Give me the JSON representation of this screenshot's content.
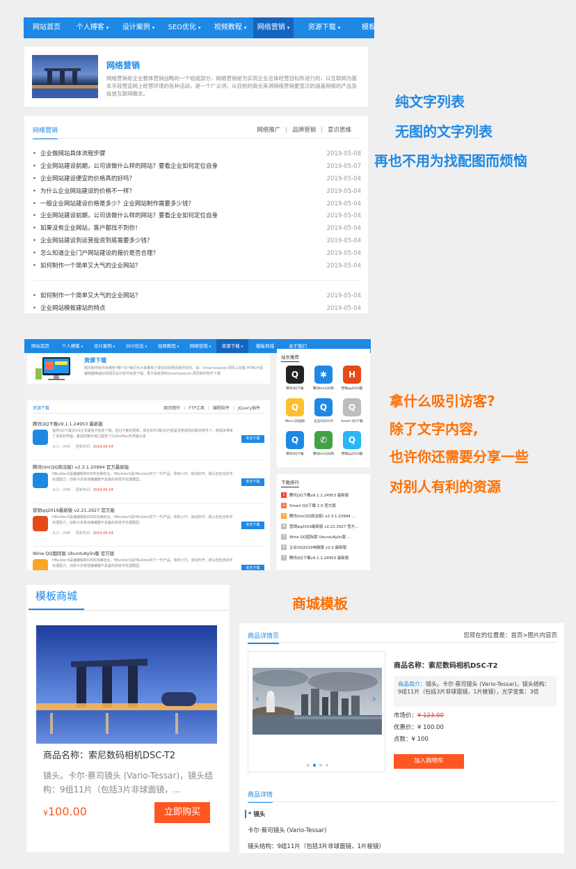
{
  "nav1": {
    "items": [
      {
        "label": "网站首页",
        "dd": false
      },
      {
        "label": "个人搏客",
        "dd": true
      },
      {
        "label": "设计案例",
        "dd": true
      },
      {
        "label": "SEO优化",
        "dd": true
      },
      {
        "label": "视频教程",
        "dd": true
      },
      {
        "label": "网络营销",
        "dd": true,
        "active": true
      },
      {
        "label": "资源下载",
        "dd": true
      },
      {
        "label": "模板商城",
        "dd": false
      }
    ],
    "caret": "▾"
  },
  "intro": {
    "title": "网络营销",
    "text": "网络营销是企业整体营销战略的一个组成部分，网络营销是为实现企业总体经营目标所进行的，以互联网为基本手段营造网上经营环境的各种活动，是一个广义词，从目前的商业来讲网络营销更宽泛的涵盖网络的产品及投放互联网概念。"
  },
  "list1": {
    "tab": "网络营销",
    "links": [
      "网络推广",
      "品牌营销",
      "意识思维"
    ],
    "sep": "|",
    "bullet": "•",
    "items": [
      {
        "t": "企业做网站具体流程步骤",
        "d": "2019-05-08"
      },
      {
        "t": "企业网站建设前期，公司该做什么样的网站？要看企业如何定位自身",
        "d": "2019-05-07"
      },
      {
        "t": "企业网站建设便宜的价格真的好吗？",
        "d": "2019-05-04"
      },
      {
        "t": "为什么企业网站建设的价格不一样？",
        "d": "2019-05-04"
      },
      {
        "t": "一般企业网站建设价格是多少？企业网站制作需要多少钱？",
        "d": "2019-05-04"
      },
      {
        "t": "企业网站建设前期，公司该做什么样的网站？要看企业如何定位自身",
        "d": "2019-05-04"
      },
      {
        "t": "如果没有企业网站，客户都找不到你！",
        "d": "2019-05-04"
      },
      {
        "t": "企业网站建设到运营投资到底需要多少钱？",
        "d": "2019-05-04"
      },
      {
        "t": "怎么知道企业门户网站建设的报价是否合理？",
        "d": "2019-05-04"
      },
      {
        "t": "如何制作一个简单又大气的企业网站？",
        "d": "2019-05-04"
      }
    ],
    "items2": [
      {
        "t": "如何制作一个简单又大气的企业网站？",
        "d": "2019-05-04"
      },
      {
        "t": "企业网站模板建站的特点",
        "d": "2019-05-04"
      }
    ]
  },
  "promo1": [
    "纯文字列表",
    "无图的文字列表",
    "再也不用为找配图而烦恼"
  ],
  "nav2": {
    "items": [
      {
        "label": "网站首页",
        "dd": false
      },
      {
        "label": "个人搏客",
        "dd": true
      },
      {
        "label": "设计案例",
        "dd": true
      },
      {
        "label": "SEO优化",
        "dd": true
      },
      {
        "label": "视频教程",
        "dd": true
      },
      {
        "label": "网络营销",
        "dd": true
      },
      {
        "label": "资源下载",
        "dd": true,
        "active": true
      },
      {
        "label": "模板商城",
        "dd": false
      },
      {
        "label": "关于我们",
        "dd": false
      }
    ]
  },
  "res": {
    "title": "资源下载",
    "text": "网页制作软件有哪些?哪个好?我们为大家推荐了很多好的网页制作软件。如：Dreamweaver,网页三剑客,HTML代码编辑器等最好的网页设计软件免费下载。再不是免费的dreamweaver,网页制作软件下载"
  },
  "reslist": {
    "tab": "资源下载",
    "links": [
      "网页制作",
      "FTP工具",
      "编程软件",
      "JQuery插件"
    ],
    "btn": "安全下载",
    "size_label": "大小：",
    "time_label": "更新时间：",
    "items": [
      {
        "title": "腾讯QQ下载v9.1.1.24953 最新版",
        "desc": "提供QQ下载2019正式版官方免费下载，经过不断的更新，现在的PC端QQ已经是非常成熟的聊天软件了，新版本带来了全新的界面，集成的聊天窗口提供了QQforMac的界面元素",
        "size": "26M",
        "time": "2019-05-04",
        "icon": "qq-icon",
        "color": "#1e88e5"
      },
      {
        "title": "腾讯tim(QQ简洁版) v2.3.1.20994 官方最新版",
        "desc": "HBuilderX是编编辑和IDE的完美结合。HBuilderX是HBuilder的下一代产品。体积小巧、启动秒开。默认包包含的字处理能力，创新众多其他编编器不具备的高效字处理模型。",
        "size": "26M",
        "time": "2019-05-04",
        "icon": "tim-icon",
        "color": "#1e88e5"
      },
      {
        "title": "营销qq2019最新版 v2.21.2927 官方版",
        "desc": "HBuilderX是编编辑和IDE的完美结合。HBuilderX是HBuilder的下一代产品。体积小巧、启动秒开。默认包包含的字处理能力，创新众多其他编编器不具备的高效字处理模型。",
        "size": "26M",
        "time": "2019-05-04",
        "icon": "hbuilder-icon",
        "color": "#e64a19"
      },
      {
        "title": "Wine QQ国际版 UbuntuKylin版 官方版",
        "desc": "HBuilderX是编编辑和IDE的完美结合。HBuilderX是HBuilder的下一代产品。体积小巧、启动秒开。默认包包含的字处理能力，创新众多其他编编器不具备的高效字处理模型。",
        "size": "",
        "time": "",
        "icon": "wine-qq-icon",
        "color": "#f9a825"
      }
    ]
  },
  "recommend": {
    "title": "站长推荐",
    "items": [
      {
        "n": "腾讯QQ下载",
        "c": "#222",
        "g": "Q"
      },
      {
        "n": "腾讯tim(QQ简",
        "c": "#1e88e5",
        "g": "✱"
      },
      {
        "n": "营销qq2019最",
        "c": "#e64a19",
        "g": "H"
      },
      {
        "n": "Wine QQ国际",
        "c": "#fbc02d",
        "g": "Q"
      },
      {
        "n": "企业QQ2019",
        "c": "#1e88e5",
        "g": "Q"
      },
      {
        "n": "Smart QQ下载",
        "c": "#bdbdbd",
        "g": "Q"
      },
      {
        "n": "腾讯QQ下载",
        "c": "#1e88e5",
        "g": "Q"
      },
      {
        "n": "腾讯tim(QQ简",
        "c": "#43a047",
        "g": "✆"
      },
      {
        "n": "营销qq2019最",
        "c": "#29b6f6",
        "g": "Q"
      }
    ]
  },
  "rank": {
    "title": "下载排行",
    "items": [
      {
        "n": "1",
        "t": "腾讯QQ下载v9.1.1.24953 最新版",
        "c": "#f44336"
      },
      {
        "n": "2",
        "t": "Smart QQ下载 2.0 官方版",
        "c": "#ff7043"
      },
      {
        "n": "3",
        "t": "腾讯tim(QQ简洁版) v2.3.1.20994 ...",
        "c": "#ffa726"
      },
      {
        "n": "4",
        "t": "营销qq2019最新版 v2.21.2927 官方...",
        "c": "#bdbdbd"
      },
      {
        "n": "5",
        "t": "Wine QQ国际版 UbuntuKylin版 ...",
        "c": "#bdbdbd"
      },
      {
        "n": "6",
        "t": "企业QQ2019电脑版 v2.0 最新版",
        "c": "#bdbdbd"
      },
      {
        "n": "7",
        "t": "腾讯QQ下载v9.1.1.24953 最新版",
        "c": "#bdbdbd"
      }
    ]
  },
  "promo2": [
    "拿什么吸引访客?",
    "除了文字内容,",
    "也许你还需要分享一些",
    "对别人有利的资源"
  ],
  "shop": {
    "tab": "模板商城",
    "name": "商品名称：索尼数码相机DSC-T2",
    "desc": "镜头。卡尔·蔡司镜头 (Vario-Tessar)，镜头结构：9组11片（包括3片非球面镜，...",
    "currency": "¥",
    "price": "100.00",
    "btn": "立即购买"
  },
  "promo3": "商城模板",
  "detail": {
    "tab": "商品详情页",
    "breadcrumb": "您现在的位置是：首页>图片内容页",
    "name": "商品名称：索尼数码相机DSC-T2",
    "brief_label": "商品简介：",
    "brief": "镜头。卡尔·蔡司镜头 (Vario-Tessar)，镜头结构：9组11片（包括3片非球面镜，1片棱镜），光学变焦：3倍",
    "market_label": "市场价：",
    "market": "¥ 123.00",
    "sale_label": "优惠价：",
    "sale": "¥ 100.00",
    "points_label": "点数：",
    "points": "¥ 100",
    "cart": "加入购物车",
    "info_tab": "商品详情",
    "h": "* 镜头",
    "p1": "卡尔·蔡司镜头 (Vario-Tessar)",
    "p2": "镜头结构：9组11片（包括3片非球面镜，1片棱镜）",
    "carousel": {
      "count": 4,
      "active": 1
    }
  }
}
